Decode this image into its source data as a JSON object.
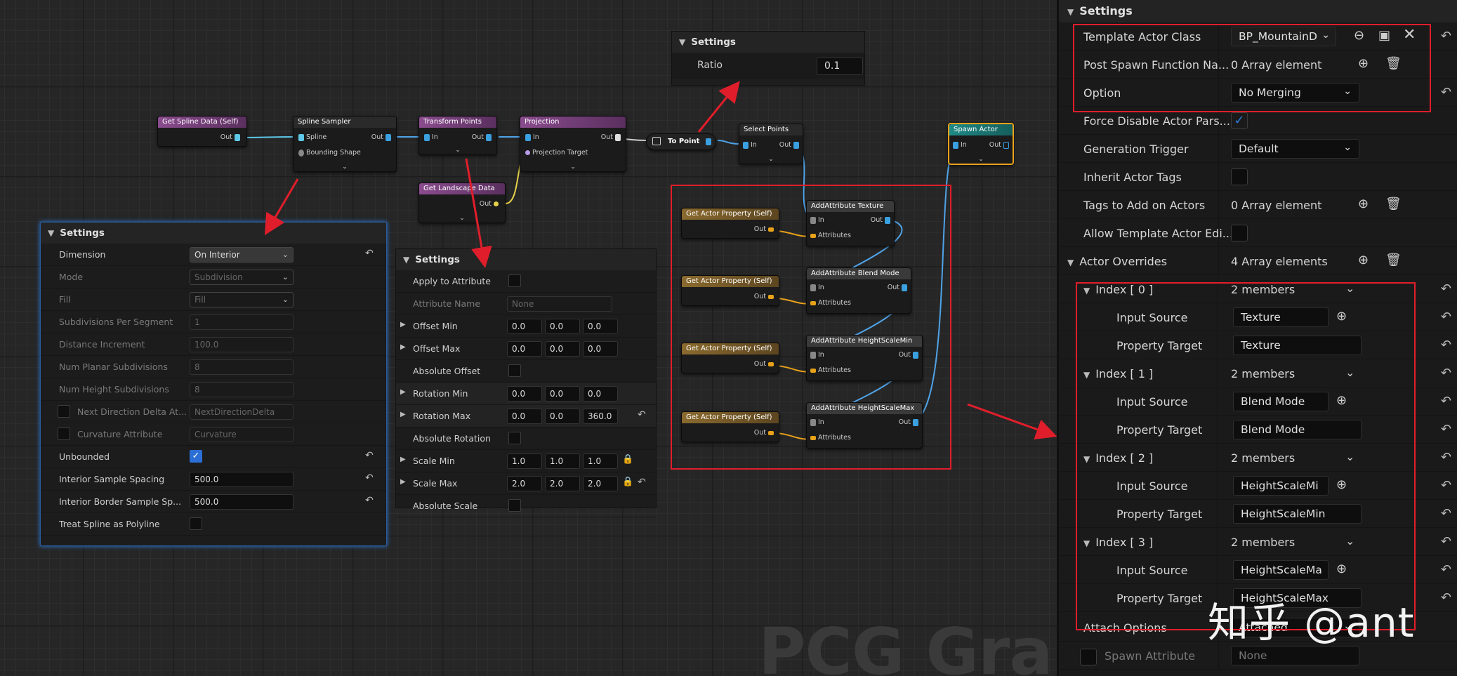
{
  "graph": {
    "watermark": "PCG Graph",
    "nodes": {
      "get_spline": {
        "title": "Get Spline Data (Self)",
        "out": "Out"
      },
      "spline_sampler": {
        "title": "Spline Sampler",
        "spline": "Spline",
        "out": "Out",
        "bounding": "Bounding Shape"
      },
      "transform_points": {
        "title": "Transform Points",
        "in": "In",
        "out": "Out"
      },
      "projection": {
        "title": "Projection",
        "in": "In",
        "out": "Out",
        "target": "Projection Target"
      },
      "get_landscape": {
        "title": "Get Landscape Data",
        "out": "Out"
      },
      "to_point": {
        "title": "To Point"
      },
      "select_points": {
        "title": "Select Points",
        "in": "In",
        "out": "Out"
      },
      "spawn_actor": {
        "title": "Spawn Actor",
        "in": "In",
        "out": "Out"
      },
      "get_actor_props": [
        {
          "title": "Get Actor Property (Self)",
          "out": "Out"
        },
        {
          "title": "Get Actor Property (Self)",
          "out": "Out"
        },
        {
          "title": "Get Actor Property (Self)",
          "out": "Out"
        },
        {
          "title": "Get Actor Property (Self)",
          "out": "Out"
        }
      ],
      "add_attrs": [
        {
          "title": "AddAttribute Texture",
          "in": "In",
          "out": "Out",
          "attr": "Attributes"
        },
        {
          "title": "AddAttribute Blend Mode",
          "in": "In",
          "out": "Out",
          "attr": "Attributes"
        },
        {
          "title": "AddAttribute HeightScaleMin",
          "in": "In",
          "out": "Out",
          "attr": "Attributes"
        },
        {
          "title": "AddAttribute HeightScaleMax",
          "in": "In",
          "out": "Out",
          "attr": "Attributes"
        }
      ]
    },
    "ratio_panel": {
      "header": "Settings",
      "label": "Ratio",
      "value": "0.1"
    },
    "sampler_panel": {
      "header": "Settings",
      "rows": [
        {
          "label": "Dimension",
          "value": "On Interior"
        },
        {
          "label": "Mode",
          "value": "Subdivision"
        },
        {
          "label": "Fill",
          "value": "Fill"
        },
        {
          "label": "Subdivisions Per Segment",
          "value": "1"
        },
        {
          "label": "Distance Increment",
          "value": "100.0"
        },
        {
          "label": "Num Planar Subdivisions",
          "value": "8"
        },
        {
          "label": "Num Height Subdivisions",
          "value": "8"
        },
        {
          "label": "Next Direction Delta At...",
          "value": "NextDirectionDelta"
        },
        {
          "label": "Curvature Attribute",
          "value": "Curvature"
        },
        {
          "label": "Unbounded",
          "value": ""
        },
        {
          "label": "Interior Sample Spacing",
          "value": "500.0"
        },
        {
          "label": "Interior Border Sample Sp...",
          "value": "500.0"
        },
        {
          "label": "Treat Spline as Polyline",
          "value": ""
        }
      ]
    },
    "transform_panel": {
      "header": "Settings",
      "rows": [
        {
          "label": "Apply to Attribute",
          "vals": []
        },
        {
          "label": "Attribute Name",
          "vals": [
            "None"
          ]
        },
        {
          "label": "Offset Min",
          "vals": [
            "0.0",
            "0.0",
            "0.0"
          ]
        },
        {
          "label": "Offset Max",
          "vals": [
            "0.0",
            "0.0",
            "0.0"
          ]
        },
        {
          "label": "Absolute Offset",
          "vals": []
        },
        {
          "label": "Rotation Min",
          "vals": [
            "0.0",
            "0.0",
            "0.0"
          ]
        },
        {
          "label": "Rotation Max",
          "vals": [
            "0.0",
            "0.0",
            "360.0"
          ]
        },
        {
          "label": "Absolute Rotation",
          "vals": []
        },
        {
          "label": "Scale Min",
          "vals": [
            "1.0",
            "1.0",
            "1.0"
          ]
        },
        {
          "label": "Scale Max",
          "vals": [
            "2.0",
            "2.0",
            "2.0"
          ]
        },
        {
          "label": "Absolute Scale",
          "vals": []
        }
      ]
    }
  },
  "details": {
    "header": "Settings",
    "template_actor_class": {
      "label": "Template Actor Class",
      "value": "BP_MountainD"
    },
    "post_spawn": {
      "label": "Post Spawn Function Na...",
      "value": "0 Array element"
    },
    "option": {
      "label": "Option",
      "value": "No Merging"
    },
    "force_disable": {
      "label": "Force Disable Actor Pars..."
    },
    "generation_trigger": {
      "label": "Generation Trigger",
      "value": "Default"
    },
    "inherit_tags": {
      "label": "Inherit Actor Tags"
    },
    "tags_to_add": {
      "label": "Tags to Add on Actors",
      "value": "0 Array element"
    },
    "allow_template": {
      "label": "Allow Template Actor Edi..."
    },
    "actor_overrides": {
      "label": "Actor Overrides",
      "value": "4 Array elements"
    },
    "indices": [
      {
        "label": "Index [ 0 ]",
        "value": "2 members",
        "input_label": "Input Source",
        "input": "Texture",
        "target_label": "Property Target",
        "target": "Texture"
      },
      {
        "label": "Index [ 1 ]",
        "value": "2 members",
        "input_label": "Input Source",
        "input": "Blend Mode",
        "target_label": "Property Target",
        "target": "Blend Mode"
      },
      {
        "label": "Index [ 2 ]",
        "value": "2 members",
        "input_label": "Input Source",
        "input": "HeightScaleMi",
        "target_label": "Property Target",
        "target": "HeightScaleMin"
      },
      {
        "label": "Index [ 3 ]",
        "value": "2 members",
        "input_label": "Input Source",
        "input": "HeightScaleMa",
        "target_label": "Property Target",
        "target": "HeightScaleMax"
      }
    ],
    "attach_options": {
      "label": "Attach Options",
      "value": "Attached"
    },
    "spawn_attribute": {
      "label": "Spawn Attribute",
      "value": "None"
    }
  },
  "watermark_text": "知乎 @ant",
  "colors": {
    "annotation_red": "#e01e2b",
    "selection_orange": "#e8a21a",
    "checkbox_blue": "#2b6fd6"
  }
}
